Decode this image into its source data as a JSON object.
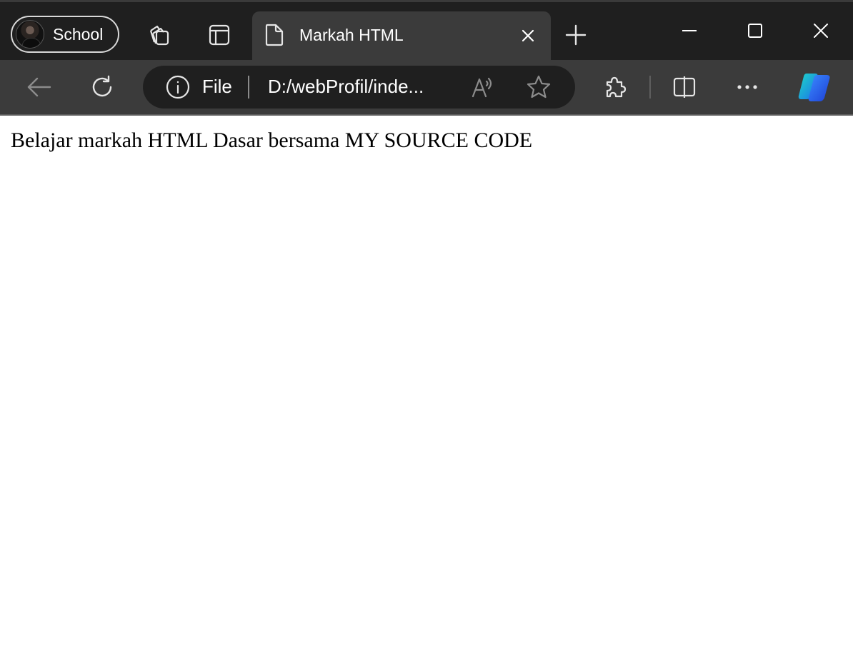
{
  "browser": {
    "profile": {
      "label": "School",
      "avatar_icon": "user-avatar-icon"
    },
    "tab_strip": {
      "workspaces_icon": "workspaces-icon",
      "tab_actions_icon": "tab-actions-icon",
      "tabs": [
        {
          "title": "Markah HTML",
          "icon": "document-icon",
          "active": true
        }
      ],
      "new_tab_icon": "plus-icon"
    },
    "window_controls": [
      "minimize-icon",
      "maximize-icon",
      "close-icon"
    ],
    "toolbar": {
      "back_icon": "back-arrow-icon",
      "refresh_icon": "refresh-icon",
      "address_bar": {
        "site_info_icon": "info-icon",
        "scheme_label": "File",
        "url": "D:/webProfil/inde..."
      },
      "read_aloud_icon": "read-aloud-icon",
      "favorite_icon": "star-icon",
      "extensions_icon": "puzzle-icon",
      "split_screen_icon": "split-screen-icon",
      "more_icon": "more-icon",
      "copilot_icon": "copilot-icon"
    },
    "colors": {
      "titlebar": "#1f1f1f",
      "toolbar": "#3b3b3b",
      "active_tab": "#3b3b3b",
      "address_bar": "#1f1f1f",
      "page_background": "#ffffff"
    }
  },
  "page": {
    "text": "Belajar markah HTML Dasar bersama MY SOURCE CODE"
  }
}
